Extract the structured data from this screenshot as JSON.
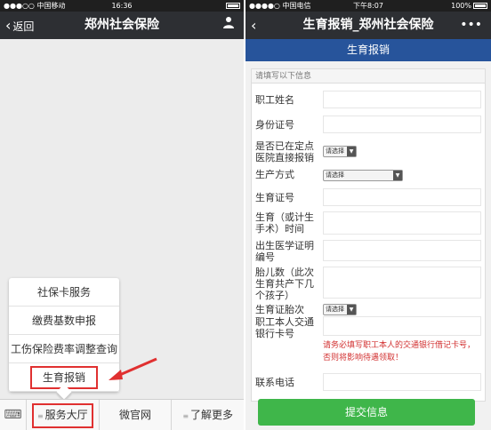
{
  "left": {
    "status": {
      "carrier": "●●●○○ 中国移动",
      "time": "16:36",
      "right": "● ▮▮"
    },
    "nav": {
      "back": "返回",
      "title": "郑州社会保险",
      "right_icon": "person-icon"
    },
    "menu": [
      "社保卡服务",
      "缴费基数申报",
      "工伤保险费率调整查询",
      "生育报销"
    ],
    "tabs": [
      "服务大厅",
      "微官网",
      "了解更多"
    ]
  },
  "right": {
    "status": {
      "carrier": "●●●●○ 中国电信",
      "time": "下午8:07",
      "right": "100%"
    },
    "nav": {
      "back": "生育报销_郑州社会保险",
      "right_icon": "more-icon"
    },
    "subhead": "生育报销",
    "hint": "请填写以下信息",
    "fields": {
      "name": "职工姓名",
      "id": "身份证号",
      "direct": "是否已在定点医院直接报销",
      "method": "生产方式",
      "cert": "生育证号",
      "date": "生育（或计生手术）时间",
      "birth_cert": "出生医学证明编号",
      "fetus": "胎儿数（此次生育共产下几个孩子）",
      "order": "生育证胎次",
      "bank": "职工本人交通银行卡号",
      "phone": "联系电话"
    },
    "select_placeholder": "请选择",
    "warning": "请务必填写职工本人的交通银行借记卡号，否则将影响待遇领取！",
    "submit": "提交信息"
  },
  "colors": {
    "accent_green": "#3fb64a",
    "header_blue": "#27549b",
    "highlight_red": "#e03030"
  }
}
